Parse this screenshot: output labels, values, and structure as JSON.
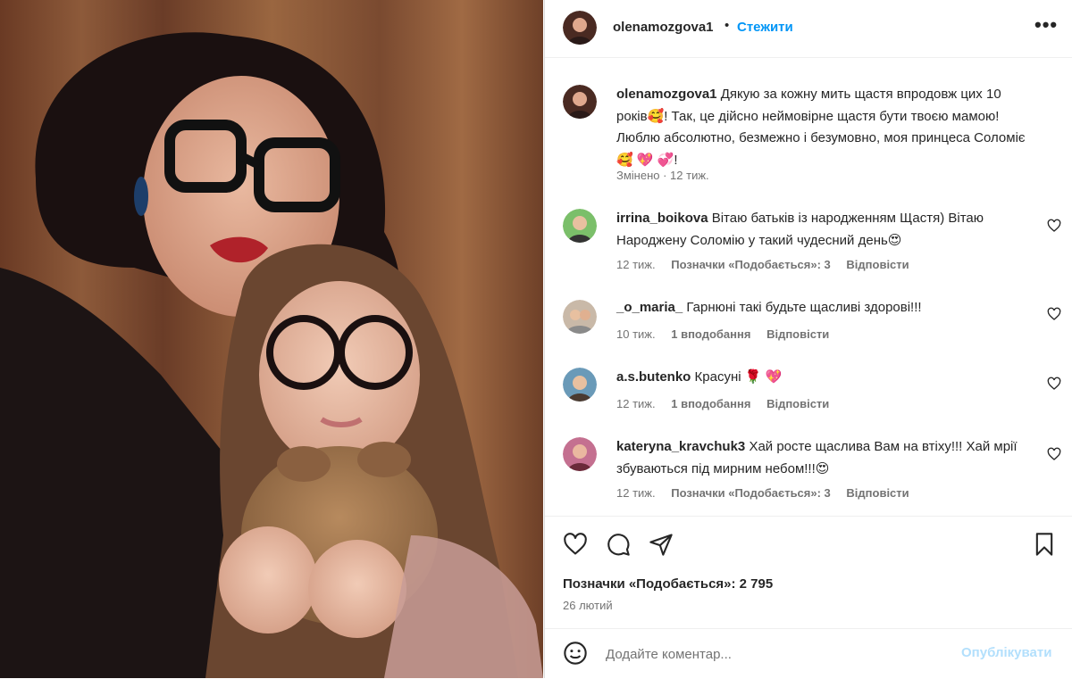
{
  "post": {
    "author": "olenamozgova1",
    "follow_label": "Стежити",
    "more_label": "•••",
    "caption_user": "olenamozgova1",
    "caption_text": "Дякую за кожну мить щастя впродовж цих 10 років🥰! Так, це дійсно неймовірне щастя бути твоєю мамою! Люблю абсолютно, безмежно і безумовно, моя принцеса Соломіє 🥰 💖 💞!",
    "caption_meta": "Змінено · 12 тиж."
  },
  "comments": [
    {
      "user": "irrina_boikova",
      "text": "Вітаю батьків із народженням Щастя) Вітаю Народжену Соломію у такий чудесний день😍",
      "time": "12 тиж.",
      "likes": "Позначки «Подобається»: 3",
      "reply": "Відповісти"
    },
    {
      "user": "_o_maria_",
      "text": "Гарнюні такі будьте щасливі здорові!!!",
      "time": "10 тиж.",
      "likes": "1 вподобання",
      "reply": "Відповісти"
    },
    {
      "user": "a.s.butenko",
      "text": "Красуні 🌹 💖",
      "time": "12 тиж.",
      "likes": "1 вподобання",
      "reply": "Відповісти"
    },
    {
      "user": "kateryna_kravchuk3",
      "text": "Хай росте щаслива Вам на втіху!!! Хай мрії збуваються під мирним небом!!!😍",
      "time": "12 тиж.",
      "likes": "Позначки «Подобається»: 3",
      "reply": "Відповісти"
    }
  ],
  "stats": {
    "likes": "Позначки «Подобається»: 2 795",
    "date": "26 лютий"
  },
  "composer": {
    "placeholder": "Додайте коментар...",
    "publish_label": "Опублікувати"
  },
  "icons": {
    "like": "heart-icon",
    "comment": "comment-bubble-icon",
    "share": "send-icon",
    "save": "bookmark-icon",
    "emoji": "emoji-icon"
  },
  "colors": {
    "accent": "#0095f6",
    "publish_disabled": "#b2dffc",
    "muted": "#737373"
  }
}
